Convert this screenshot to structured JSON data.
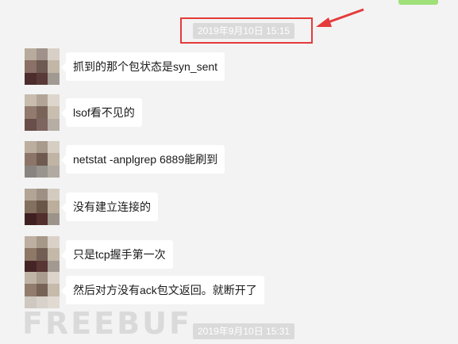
{
  "timestamps": {
    "top": "2019年9月10日 15:15",
    "bottom": "2019年9月10日 15:31"
  },
  "messages": [
    {
      "text": "抓到的那个包状态是syn_sent"
    },
    {
      "text": "lsof看不见的"
    },
    {
      "text": "netstat -anplgrep 6889能刷到"
    },
    {
      "text": "没有建立连接的"
    },
    {
      "text": "只是tcp握手第一次"
    },
    {
      "text": "然后对方没有ack包文返回。就断开了"
    }
  ],
  "watermark": "FREEBUF",
  "colors": {
    "highlight": "#e53a3a",
    "bubble": "#ffffff",
    "background": "#f3f3f3",
    "timestamp_bg": "#dadada"
  }
}
